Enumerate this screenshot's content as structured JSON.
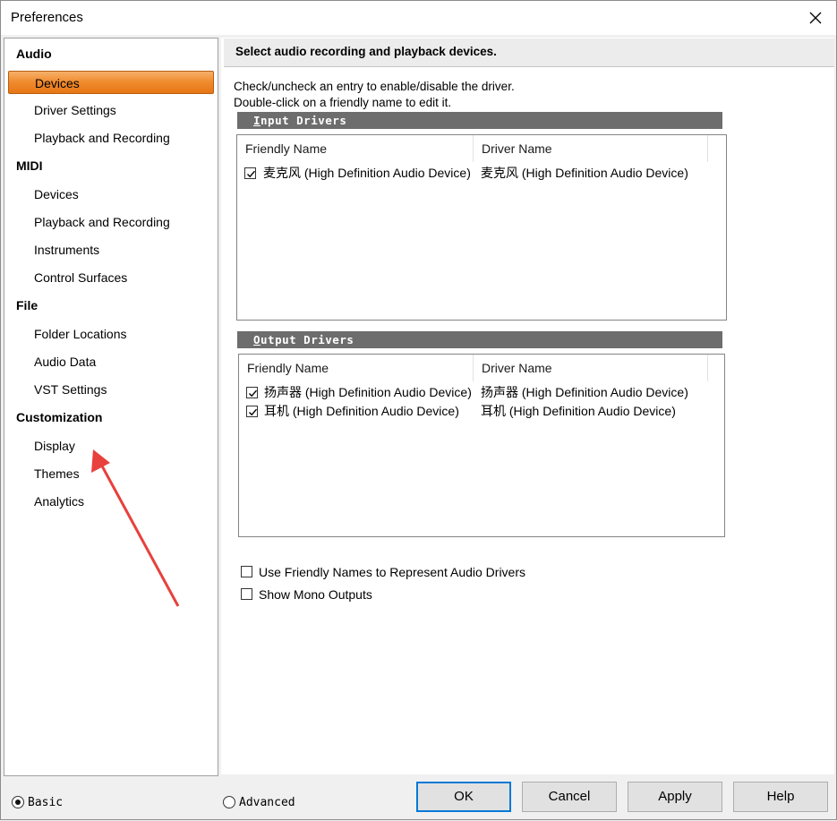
{
  "window": {
    "title": "Preferences"
  },
  "sidebar": {
    "groups": [
      {
        "label": "Audio",
        "items": [
          "Devices",
          "Driver Settings",
          "Playback and Recording"
        ]
      },
      {
        "label": "MIDI",
        "items": [
          "Devices",
          "Playback and Recording",
          "Instruments",
          "Control Surfaces"
        ]
      },
      {
        "label": "File",
        "items": [
          "Folder Locations",
          "Audio Data",
          "VST Settings"
        ]
      },
      {
        "label": "Customization",
        "items": [
          "Display",
          "Themes",
          "Analytics"
        ]
      }
    ],
    "selected": "Audio > Devices"
  },
  "main": {
    "header": "Select audio recording and playback devices.",
    "instructions": [
      "Check/uncheck an entry to enable/disable the driver.",
      "Double-click on a friendly name to edit it."
    ],
    "input_section": {
      "title_first": "I",
      "title_rest": "nput Drivers"
    },
    "output_section": {
      "title_first": "O",
      "title_rest": "utput Drivers"
    },
    "columns": {
      "friendly": "Friendly Name",
      "driver": "Driver Name"
    },
    "input_drivers": [
      {
        "checked": true,
        "friendly": "麦克风 (High Definition Audio Device)",
        "driver": "麦克风 (High Definition Audio Device)"
      }
    ],
    "output_drivers": [
      {
        "checked": true,
        "friendly": "扬声器 (High Definition Audio Device)",
        "driver": "扬声器 (High Definition Audio Device)"
      },
      {
        "checked": true,
        "friendly": "耳机 (High Definition Audio Device)",
        "driver": "耳机 (High Definition Audio Device)"
      }
    ],
    "options": [
      {
        "checked": false,
        "label": "Use Friendly Names to Represent Audio Drivers"
      },
      {
        "checked": false,
        "label": "Show Mono Outputs"
      }
    ]
  },
  "footer": {
    "view_mode": {
      "basic": "Basic",
      "advanced": "Advanced",
      "selected": "Basic"
    },
    "buttons": {
      "ok": "OK",
      "cancel": "Cancel",
      "apply": "Apply",
      "help": "Help"
    }
  },
  "colors": {
    "selection": "#f08a2c",
    "section_bar": "#6d6d6d",
    "arrow": "#e8403c",
    "focus": "#0078d7"
  }
}
